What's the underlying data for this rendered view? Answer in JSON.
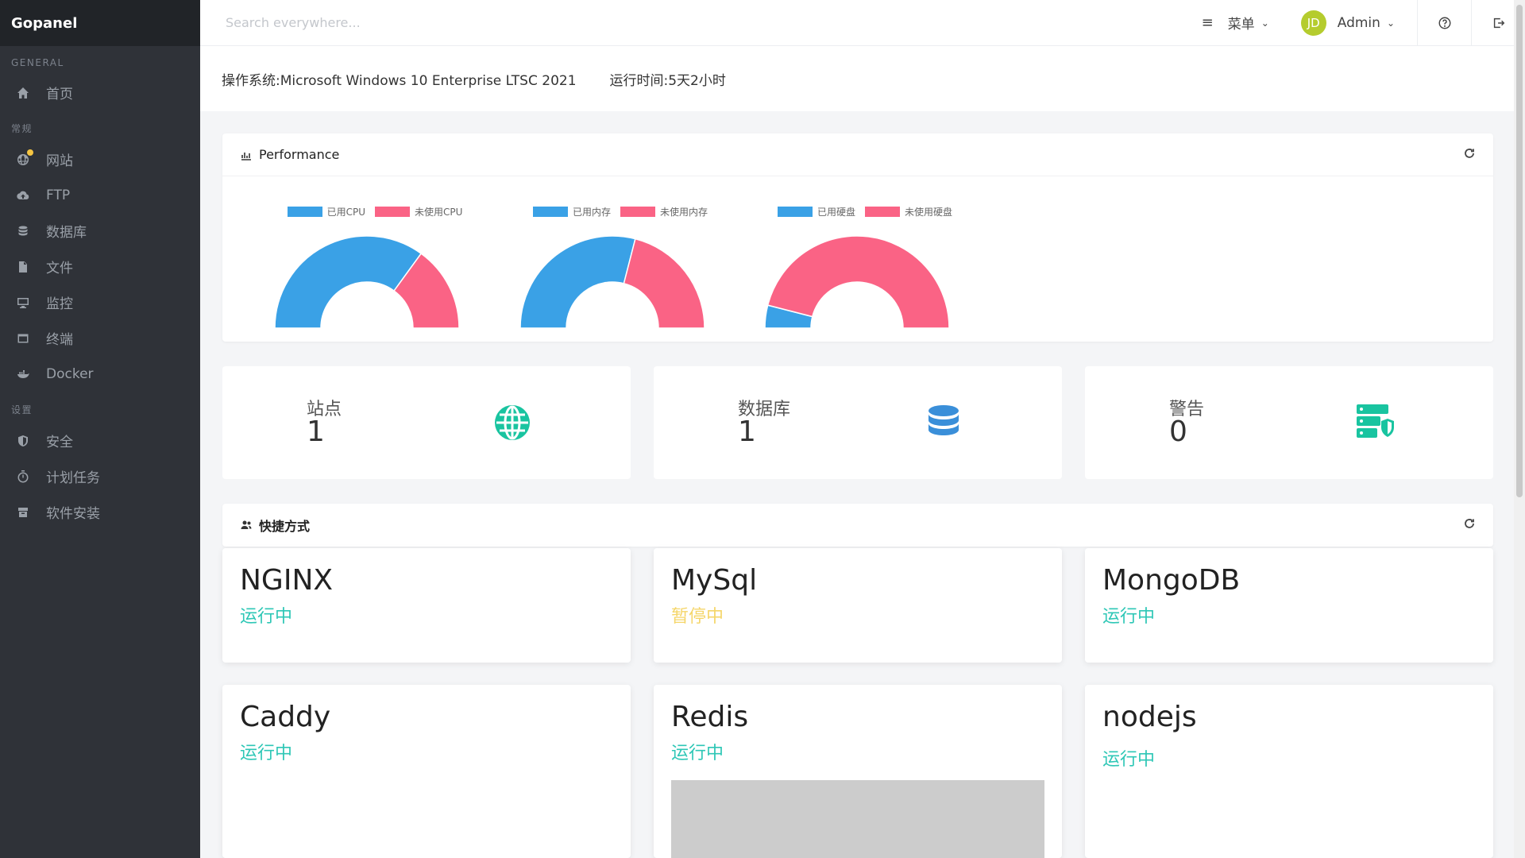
{
  "app": {
    "brand": "Gopanel"
  },
  "sidebar": {
    "sections": [
      "GENERAL",
      "常规",
      "设置"
    ],
    "items": [
      {
        "label": "首页",
        "icon": "home-icon"
      },
      {
        "label": "网站",
        "icon": "globe-icon"
      },
      {
        "label": "FTP",
        "icon": "cloud-upload-icon"
      },
      {
        "label": "数据库",
        "icon": "database-icon"
      },
      {
        "label": "文件",
        "icon": "file-icon"
      },
      {
        "label": "监控",
        "icon": "monitor-icon"
      },
      {
        "label": "终端",
        "icon": "terminal-icon"
      },
      {
        "label": "Docker",
        "icon": "docker-icon"
      },
      {
        "label": "安全",
        "icon": "shield-icon"
      },
      {
        "label": "计划任务",
        "icon": "timer-icon"
      },
      {
        "label": "软件安装",
        "icon": "package-icon"
      }
    ]
  },
  "header": {
    "search_placeholder": "Search everywhere...",
    "menu_label": "菜单",
    "avatar_initials": "JD",
    "user_name": "Admin"
  },
  "info": {
    "os": "操作系统:Microsoft Windows 10 Enterprise LTSC 2021",
    "uptime": "运行时间:5天2小时"
  },
  "performance": {
    "title": "Performance",
    "colors": {
      "used": "#3aa1e6",
      "unused": "#fa6385"
    }
  },
  "chart_data": [
    {
      "type": "pie",
      "subtype": "half-doughnut",
      "labels": [
        "已用CPU",
        "未使用CPU"
      ],
      "values": [
        70,
        30
      ]
    },
    {
      "type": "pie",
      "subtype": "half-doughnut",
      "labels": [
        "已用内存",
        "未使用内存"
      ],
      "values": [
        58,
        42
      ]
    },
    {
      "type": "pie",
      "subtype": "half-doughnut",
      "labels": [
        "已用硬盘",
        "未使用硬盘"
      ],
      "values": [
        8,
        92
      ]
    }
  ],
  "stats": [
    {
      "label": "站点",
      "value": "1",
      "icon": "globe-icon"
    },
    {
      "label": "数据库",
      "value": "1",
      "icon": "database-icon"
    },
    {
      "label": "警告",
      "value": "0",
      "icon": "server-shield-icon"
    }
  ],
  "shortcuts": {
    "title": "快捷方式",
    "items": [
      {
        "name": "NGINX",
        "status": "运行中",
        "state": "running"
      },
      {
        "name": "MySql",
        "status": "暂停中",
        "state": "stopped"
      },
      {
        "name": "MongoDB",
        "status": "运行中",
        "state": "running"
      },
      {
        "name": "Caddy",
        "status": "运行中",
        "state": "running"
      },
      {
        "name": "Redis",
        "status": "运行中",
        "state": "running"
      },
      {
        "name": "nodejs",
        "status": "运行中",
        "state": "running"
      }
    ]
  }
}
